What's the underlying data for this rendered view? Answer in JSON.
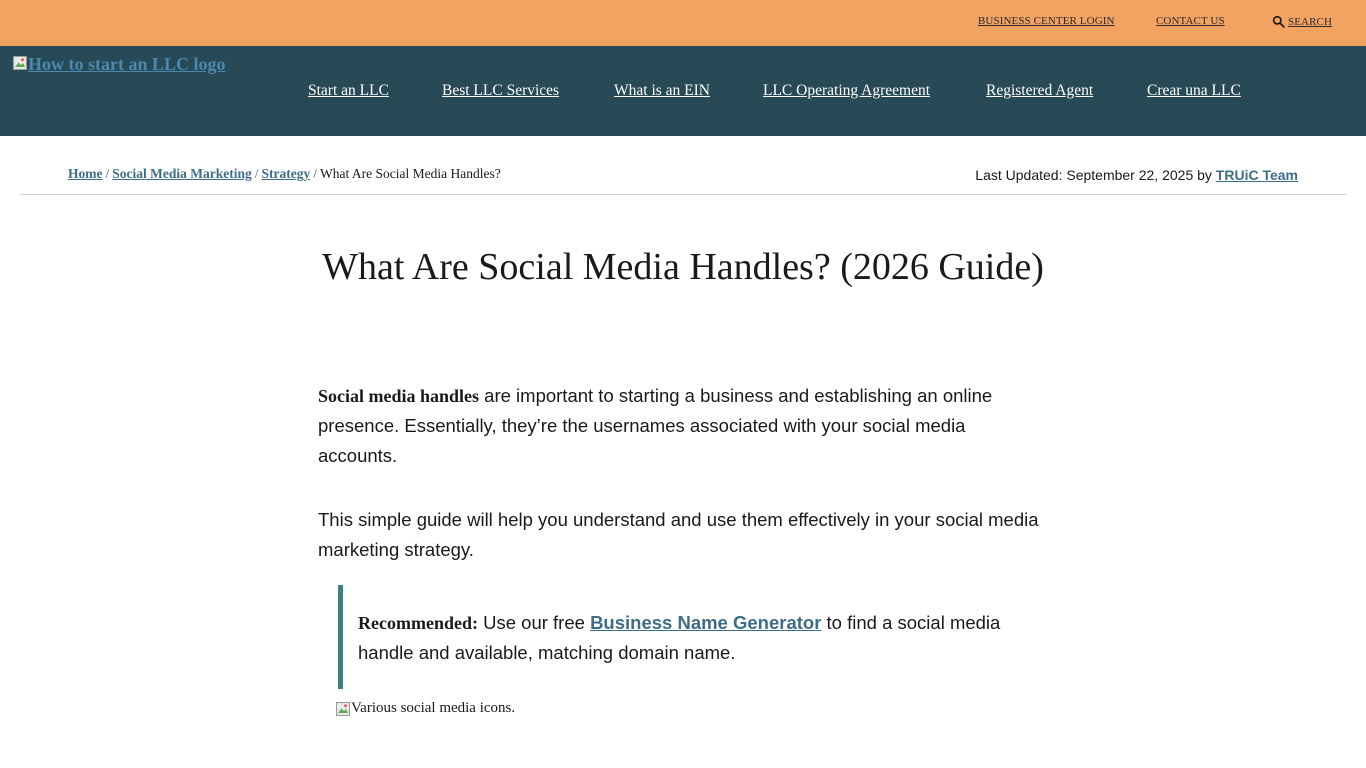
{
  "topbar": {
    "business_center_login": "BUSINESS CENTER LOGIN",
    "contact_us": "CONTACT US",
    "search": "SEARCH"
  },
  "logo": {
    "alt": "How to start an LLC logo"
  },
  "nav": {
    "items": [
      {
        "label": "Start an LLC"
      },
      {
        "label": "Best LLC Services"
      },
      {
        "label": "What is an EIN"
      },
      {
        "label": "LLC Operating Agreement"
      },
      {
        "label": "Registered Agent"
      },
      {
        "label": "Crear una LLC"
      }
    ]
  },
  "breadcrumb": {
    "home": "Home",
    "social_media_marketing": "Social Media Marketing",
    "strategy": "Strategy",
    "current": "What Are Social Media Handles?",
    "separator": "/"
  },
  "updated": {
    "prefix": "Last Updated: September 22, 2025 by",
    "author": "TRUiC Team"
  },
  "article": {
    "title": "What Are Social Media Handles? (2026 Guide)",
    "p1_bold": "Social media handles",
    "p1_rest": " are important to starting a business and establishing an online presence. Essentially, they’re the usernames associated with your social media accounts.",
    "p2": "This simple guide will help you understand and use them effectively in your social media marketing strategy.",
    "callout_bold": "Recommended:",
    "callout_pre": " Use our free ",
    "callout_link": "Business Name Generator",
    "callout_post": " to find a social media handle and available, matching domain name.",
    "image_alt": "Various social media icons."
  }
}
